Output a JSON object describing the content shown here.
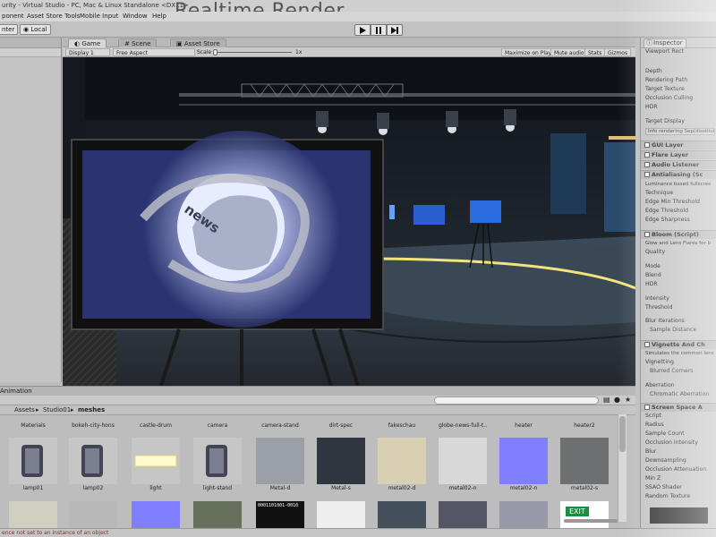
{
  "window": {
    "title": "urity - Virtual Studio - PC, Mac & Linux Standalone <DX11>"
  },
  "heading": "Realtime Render",
  "menu": [
    "ponent",
    "Asset Store Tools",
    "Mobile Input",
    "Window",
    "Help"
  ],
  "toolbar": {
    "left_buttons": [
      "nter",
      "Local"
    ]
  },
  "tabs": [
    "Game",
    "Scene",
    "Asset Store"
  ],
  "gamebar": {
    "display": "Display 1",
    "aspect": "Free Aspect",
    "scale_label": "Scale",
    "scale_value": "1x",
    "maximize": "Maximize on Play",
    "mute": "Mute audio",
    "stats": "Stats",
    "gizmos": "Gizmos"
  },
  "screen_text": "news",
  "animation_tab": "Animation",
  "breadcrumb": {
    "assets": "Assets",
    "studio": "Studio01",
    "meshes": "meshes"
  },
  "top_row_labels": [
    "Materials",
    "bokeh-city-hons",
    "castle-drum",
    "camera",
    "camera-stand",
    "dirt-spec",
    "fakeschau",
    "globe-news-full-t..",
    "heater",
    "heater2"
  ],
  "assets_row1": [
    {
      "label": "lamp01",
      "kind": "lamp"
    },
    {
      "label": "lamp02",
      "kind": "lamp"
    },
    {
      "label": "light",
      "kind": "light"
    },
    {
      "label": "light-stand",
      "kind": "stand"
    },
    {
      "label": "Metal-d",
      "kind": "metal"
    },
    {
      "label": "Metal-s",
      "kind": "metaldark"
    },
    {
      "label": "metal02-d",
      "kind": "sand"
    },
    {
      "label": "metal02-n",
      "kind": "white"
    },
    {
      "label": "metal02-n",
      "kind": "normal"
    },
    {
      "label": "metal02-s",
      "kind": "grey"
    }
  ],
  "row3_text": "0001101001-0010",
  "exit_sign": "EXIT",
  "status": "ence not set to an instance of an object",
  "inspector": {
    "tab": "Inspector",
    "viewport": "Viewport Rect",
    "rows1": [
      "Depth",
      "Rendering Path",
      "Target Texture",
      "Occlusion Culling",
      "HDR"
    ],
    "target_display": "Target Display",
    "infobox": "Info rendering Sep(disstitute)",
    "gui_layer": "GUI Layer",
    "flare_layer": "Flare Layer",
    "audio_listener": "Audio Listener",
    "antialiasing": "Antialiasing (Sc",
    "aa_desc": "Luminance based fullscree",
    "aa_rows": [
      "Technique",
      "Edge Min Threshold",
      "Edge Threshold",
      "Edge Sharpness"
    ],
    "bloom": "Bloom (Script)",
    "bloom_desc": "Glow and Lens Flares for b",
    "bloom_rows": [
      "Quality",
      "Mode",
      "Blend",
      "HDR",
      "Intensity",
      "Threshold",
      "Blur Iterations",
      "Sample Distance"
    ],
    "vignette": "Vignette And Ch",
    "vignette_desc": "Simulates the common lens",
    "vignette_rows": [
      "Vignetting",
      "Blurred Corners",
      "Aberration",
      "Chromatic Aberration"
    ],
    "ssao": "Screen Space A",
    "ssao_rows": [
      "Script",
      "Radius",
      "Sample Count",
      "Occlusion Intensity",
      "Blur",
      "Downsampling",
      "Occlusion Attenuation",
      "Min Z",
      "SSAO Shader",
      "Random Texture"
    ]
  }
}
